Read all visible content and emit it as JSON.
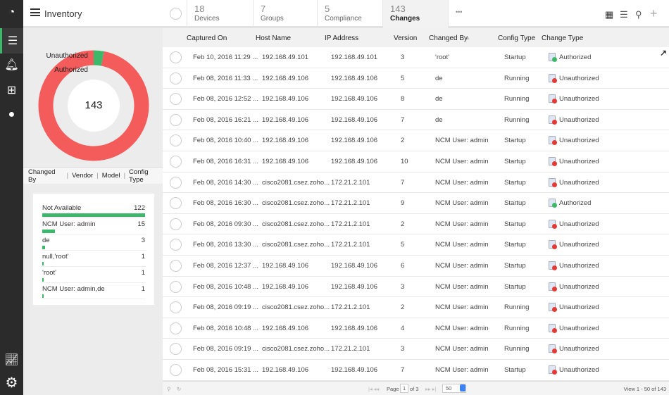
{
  "header": {
    "title": "Inventory",
    "tabs": [
      {
        "count": "18",
        "label": "Devices"
      },
      {
        "count": "7",
        "label": "Groups"
      },
      {
        "count": "5",
        "label": "Compliance"
      },
      {
        "count": "143",
        "label": "Changes"
      }
    ],
    "more": "•••"
  },
  "sidebar": {
    "icons": [
      "dashboard-icon",
      "inventory-icon",
      "alarms-icon",
      "topology-icon",
      "chat-icon",
      "reports-icon",
      "settings-icon"
    ]
  },
  "donut": {
    "total": "143",
    "labels": [
      "Unauthorized",
      "Authorized"
    ],
    "authorized_fraction": 0.03,
    "colors": {
      "unauthorized": "#f45b5b",
      "authorized": "#3db86b"
    }
  },
  "filter_tabs": [
    "Changed By",
    "Vendor",
    "Model",
    "Config Type"
  ],
  "changed_by": [
    {
      "name": "Not Available",
      "count": "122",
      "value": 122
    },
    {
      "name": "NCM User: admin",
      "count": "15",
      "value": 15
    },
    {
      "name": "de",
      "count": "3",
      "value": 3
    },
    {
      "name": "null,'root'",
      "count": "1",
      "value": 1
    },
    {
      "name": "'root'",
      "count": "1",
      "value": 1
    },
    {
      "name": "NCM User: admin,de",
      "count": "1",
      "value": 1
    }
  ],
  "table": {
    "columns": [
      "Captured On",
      "Host Name",
      "IP Address",
      "Version",
      "Changed By",
      "Config Type",
      "Change Type"
    ],
    "rows": [
      [
        "Feb 10, 2016 11:29 ...",
        "192.168.49.101",
        "192.168.49.101",
        "3",
        "'root'",
        "Startup",
        "Authorized"
      ],
      [
        "Feb 08, 2016 11:33 ...",
        "192.168.49.106",
        "192.168.49.106",
        "5",
        "de",
        "Running",
        "Unauthorized"
      ],
      [
        "Feb 08, 2016 12:52 ...",
        "192.168.49.106",
        "192.168.49.106",
        "8",
        "de",
        "Running",
        "Unauthorized"
      ],
      [
        "Feb 08, 2016 16:21 ...",
        "192.168.49.106",
        "192.168.49.106",
        "7",
        "de",
        "Running",
        "Unauthorized"
      ],
      [
        "Feb 08, 2016 10:40 ...",
        "192.168.49.106",
        "192.168.49.106",
        "2",
        "NCM User: admin",
        "Startup",
        "Unauthorized"
      ],
      [
        "Feb 08, 2016 16:31 ...",
        "192.168.49.106",
        "192.168.49.106",
        "10",
        "NCM User: admin",
        "Startup",
        "Unauthorized"
      ],
      [
        "Feb 08, 2016 14:30 ...",
        "cisco2081.csez.zoho...",
        "172.21.2.101",
        "7",
        "NCM User: admin",
        "Startup",
        "Unauthorized"
      ],
      [
        "Feb 08, 2016 16:30 ...",
        "cisco2081.csez.zoho...",
        "172.21.2.101",
        "9",
        "NCM User: admin",
        "Startup",
        "Authorized"
      ],
      [
        "Feb 08, 2016 09:30 ...",
        "cisco2081.csez.zoho...",
        "172.21.2.101",
        "2",
        "NCM User: admin",
        "Startup",
        "Unauthorized"
      ],
      [
        "Feb 08, 2016 13:30 ...",
        "cisco2081.csez.zoho...",
        "172.21.2.101",
        "5",
        "NCM User: admin",
        "Startup",
        "Unauthorized"
      ],
      [
        "Feb 08, 2016 12:37 ...",
        "192.168.49.106",
        "192.168.49.106",
        "6",
        "NCM User: admin",
        "Startup",
        "Unauthorized"
      ],
      [
        "Feb 08, 2016 10:48 ...",
        "192.168.49.106",
        "192.168.49.106",
        "3",
        "NCM User: admin",
        "Startup",
        "Unauthorized"
      ],
      [
        "Feb 08, 2016 09:19 ...",
        "cisco2081.csez.zoho...",
        "172.21.2.101",
        "2",
        "NCM User: admin",
        "Running",
        "Unauthorized"
      ],
      [
        "Feb 08, 2016 10:48 ...",
        "192.168.49.106",
        "192.168.49.106",
        "4",
        "NCM User: admin",
        "Running",
        "Unauthorized"
      ],
      [
        "Feb 08, 2016 09:19 ...",
        "cisco2081.csez.zoho...",
        "172.21.2.101",
        "3",
        "NCM User: admin",
        "Running",
        "Unauthorized"
      ],
      [
        "Feb 08, 2016 15:31 ...",
        "192.168.49.106",
        "192.168.49.106",
        "7",
        "NCM User: admin",
        "Startup",
        "Unauthorized"
      ]
    ]
  },
  "footer": {
    "page_label": "Page",
    "page": "1",
    "of": "of 3",
    "page_size": "50",
    "view": "View 1 - 50 of 143"
  }
}
